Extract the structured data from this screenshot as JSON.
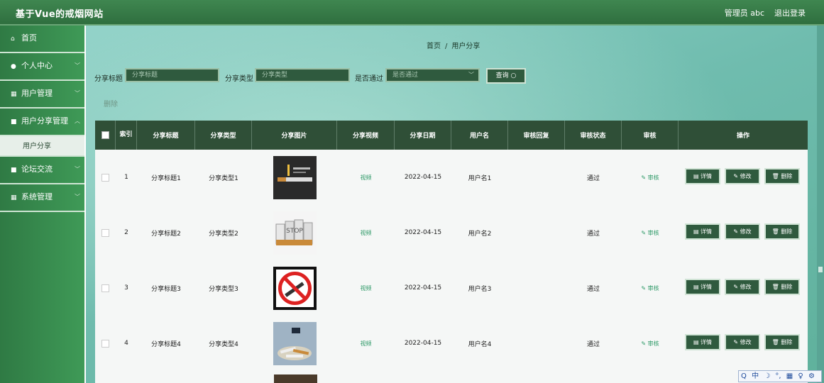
{
  "header": {
    "site_title": "基于Vue的戒烟网站",
    "admin_label": "管理员 abc",
    "logout_label": "退出登录"
  },
  "sidebar": {
    "items": [
      {
        "label": "首页",
        "icon": "home-icon",
        "has_chevron": false
      },
      {
        "label": "个人中心",
        "icon": "user-icon",
        "has_chevron": true
      },
      {
        "label": "用户管理",
        "icon": "grid-icon",
        "has_chevron": true
      },
      {
        "label": "用户分享管理",
        "icon": "doc-icon",
        "has_chevron": true
      },
      {
        "label": "论坛交流",
        "icon": "chat-icon",
        "has_chevron": true
      },
      {
        "label": "系统管理",
        "icon": "grid-icon",
        "has_chevron": true
      }
    ],
    "sub_item": "用户分享"
  },
  "breadcrumb": {
    "home": "首页",
    "separator": "/",
    "current": "用户分享"
  },
  "search": {
    "title_label": "分享标题",
    "title_placeholder": "分享标题",
    "type_label": "分享类型",
    "type_placeholder": "分享类型",
    "approved_label": "是否通过",
    "approved_placeholder": "是否通过",
    "query_button": "查询 ○"
  },
  "toolbar": {
    "delete_label": "删除"
  },
  "table": {
    "columns": [
      "",
      "索引",
      "分享标题",
      "分享类型",
      "分享图片",
      "分享视频",
      "分享日期",
      "用户名",
      "审核回复",
      "审核状态",
      "审核",
      "操作"
    ],
    "rows": [
      {
        "index": "1",
        "title": "分享标题1",
        "type": "分享类型1",
        "video": "视频",
        "date": "2022-04-15",
        "username": "用户名1",
        "reply": "",
        "status": "通过",
        "review": "审核",
        "image": "cigarette-dark-image"
      },
      {
        "index": "2",
        "title": "分享标题2",
        "type": "分享类型2",
        "video": "视频",
        "date": "2022-04-15",
        "username": "用户名2",
        "reply": "",
        "status": "通过",
        "review": "审核",
        "image": "stop-cigarettes-image"
      },
      {
        "index": "3",
        "title": "分享标题3",
        "type": "分享类型3",
        "video": "视频",
        "date": "2022-04-15",
        "username": "用户名3",
        "reply": "",
        "status": "通过",
        "review": "审核",
        "image": "no-smoking-sign-image"
      },
      {
        "index": "4",
        "title": "分享标题4",
        "type": "分享类型4",
        "video": "视频",
        "date": "2022-04-15",
        "username": "用户名4",
        "reply": "",
        "status": "通过",
        "review": "审核",
        "image": "cigarette-pile-image"
      }
    ],
    "actions": {
      "detail": "▤ 详情",
      "edit": "✎ 修改",
      "delete": "🗑 删除"
    }
  },
  "ime": {
    "items": [
      "Q",
      "中",
      "☽",
      "°,",
      "▦",
      "♀",
      "⚙"
    ]
  },
  "colors": {
    "header": "#2f6f3f",
    "sidebar": "#3f9a57",
    "table_header": "#2f4f37",
    "button": "#2f5a3e",
    "link": "#2f9a68"
  }
}
